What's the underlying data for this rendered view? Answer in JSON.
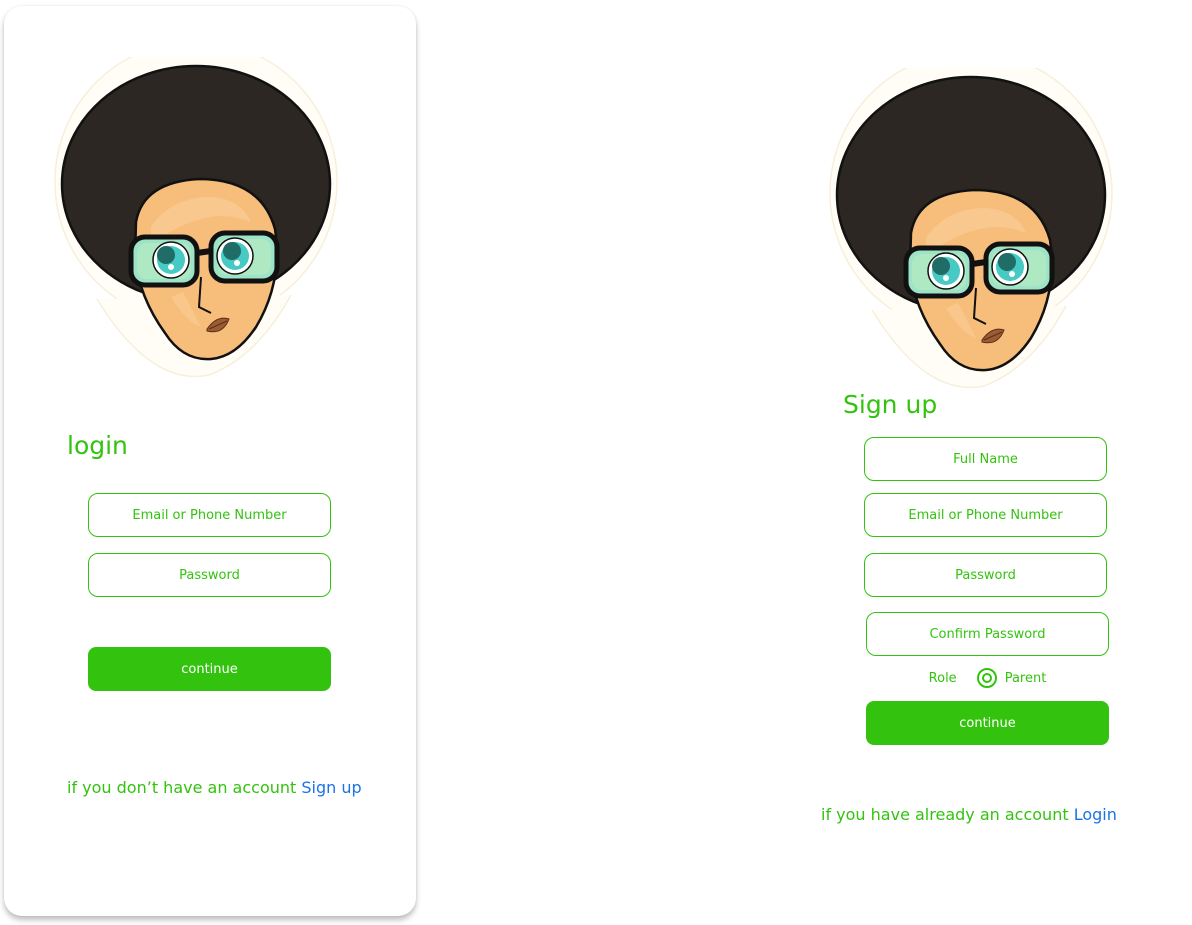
{
  "colors": {
    "accent": "#33c30f",
    "link": "#1a73e8",
    "button_text": "#ffffff",
    "hair": "#2c2722",
    "skin": "#f7bd7a",
    "lens": "#9de3c8",
    "iris": "#47c9c4"
  },
  "avatar_icon": "afro-character-with-glasses",
  "login": {
    "title": "login",
    "email_placeholder": "Email or Phone Number",
    "password_placeholder": "Password",
    "continue_label": "continue",
    "footer_text": "if you don’t have an account ",
    "footer_link": "Sign up"
  },
  "signup": {
    "title": "Sign up",
    "fullname_placeholder": "Full Name",
    "email_placeholder": "Email or Phone Number",
    "password_placeholder": "Password",
    "confirm_placeholder": "Confirm Password",
    "role_label": "Role",
    "role_option": "Parent",
    "continue_label": "continue",
    "footer_text": "if you have already an account ",
    "footer_link": "Login"
  }
}
